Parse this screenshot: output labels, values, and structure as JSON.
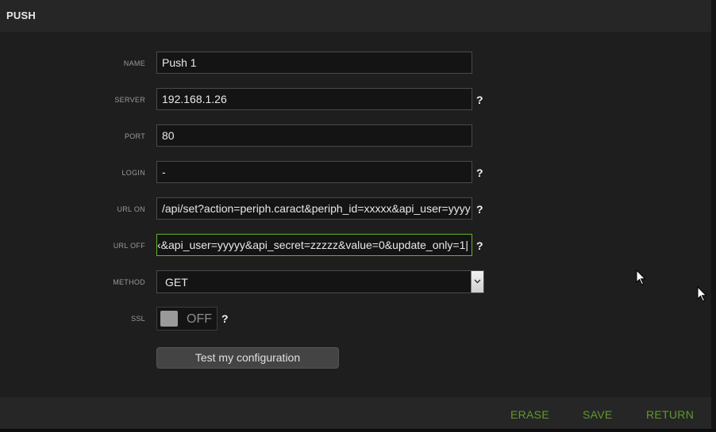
{
  "header": {
    "title": "PUSH"
  },
  "form": {
    "name": {
      "label": "NAME",
      "value": "Push 1"
    },
    "server": {
      "label": "SERVER",
      "value": "192.168.1.26",
      "help": "?"
    },
    "port": {
      "label": "PORT",
      "value": "80"
    },
    "login": {
      "label": "LOGIN",
      "value": "-",
      "help": "?"
    },
    "url_on": {
      "label": "URL ON",
      "value": "/api/set?action=periph.caract&periph_id=xxxxx&api_user=yyyy",
      "help": "?"
    },
    "url_off": {
      "label": "URL OFF",
      "value": "‹&api_user=yyyyy&api_secret=zzzzz&value=0&update_only=1|",
      "help": "?"
    },
    "method": {
      "label": "METHOD",
      "value": "GET"
    },
    "ssl": {
      "label": "SSL",
      "state": "OFF",
      "help": "?"
    },
    "test_button": "Test my configuration"
  },
  "footer": {
    "erase": "ERASE",
    "save": "SAVE",
    "return": "RETURN"
  },
  "colors": {
    "accent_green": "#5f9a2e",
    "focus_border": "#66b22a"
  },
  "icons": [
    "chevron-down-icon",
    "mouse-cursor-icon"
  ]
}
